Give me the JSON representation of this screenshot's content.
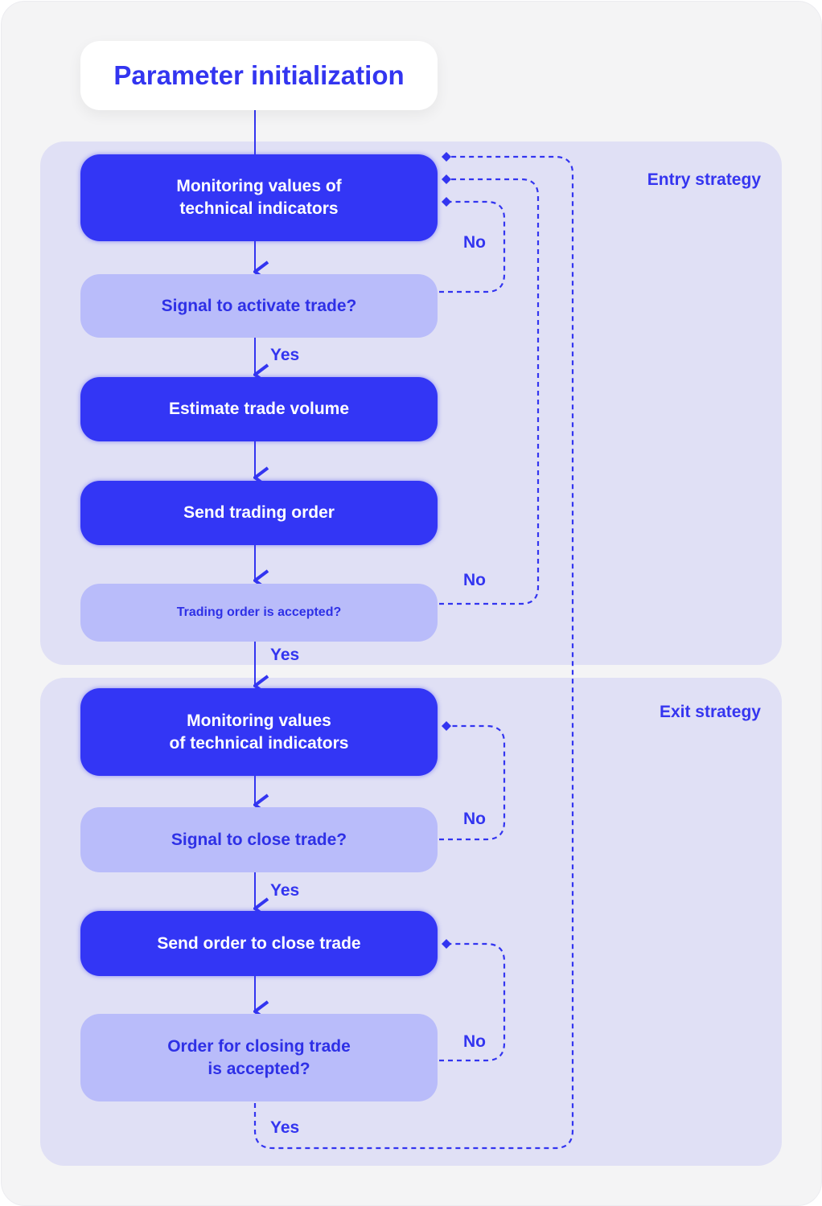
{
  "diagram": {
    "start": "Parameter initialization",
    "sections": [
      {
        "id": "entry",
        "label": "Entry strategy"
      },
      {
        "id": "exit",
        "label": "Exit strategy"
      }
    ],
    "nodes": {
      "monitor_entry": "Monitoring values of\ntechnical indicators",
      "signal_activate": "Signal to activate trade?",
      "estimate_volume": "Estimate trade volume",
      "send_order": "Send trading order",
      "order_accepted": "Trading order is accepted?",
      "monitor_exit": "Monitoring values\nof technical indicators",
      "signal_close": "Signal to close trade?",
      "send_close": "Send order to close trade",
      "close_accepted": "Order for closing trade\nis accepted?"
    },
    "edge_labels": {
      "no": "No",
      "yes": "Yes"
    },
    "colors": {
      "accent": "#3336f5",
      "decision": "#b9bcfa",
      "panel": "#e0e0f5",
      "background": "#f4f4f5"
    }
  }
}
